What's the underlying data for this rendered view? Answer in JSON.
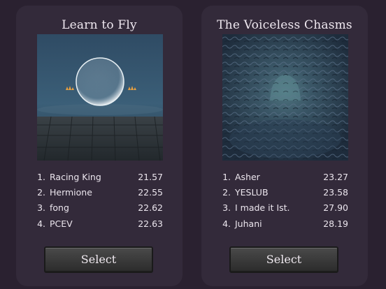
{
  "levels": [
    {
      "title": "Learn to Fly",
      "scores": [
        {
          "rank": "1.",
          "name": "Racing King",
          "time": "21.57"
        },
        {
          "rank": "2.",
          "name": "Hermione",
          "time": "22.55"
        },
        {
          "rank": "3.",
          "name": "fong",
          "time": "22.62"
        },
        {
          "rank": "4.",
          "name": "PCEV",
          "time": "22.63"
        }
      ],
      "select_label": "Select"
    },
    {
      "title": "The Voiceless Chasms",
      "scores": [
        {
          "rank": "1.",
          "name": "Asher",
          "time": "23.27"
        },
        {
          "rank": "2.",
          "name": "YESLUB",
          "time": "23.58"
        },
        {
          "rank": "3.",
          "name": "I made it Ist.",
          "time": "27.90"
        },
        {
          "rank": "4.",
          "name": "Juhani",
          "time": "28.19"
        }
      ],
      "select_label": "Select"
    }
  ],
  "colors": {
    "background": "#2a2130",
    "card": "#332a3a",
    "text": "#ece6ee"
  }
}
